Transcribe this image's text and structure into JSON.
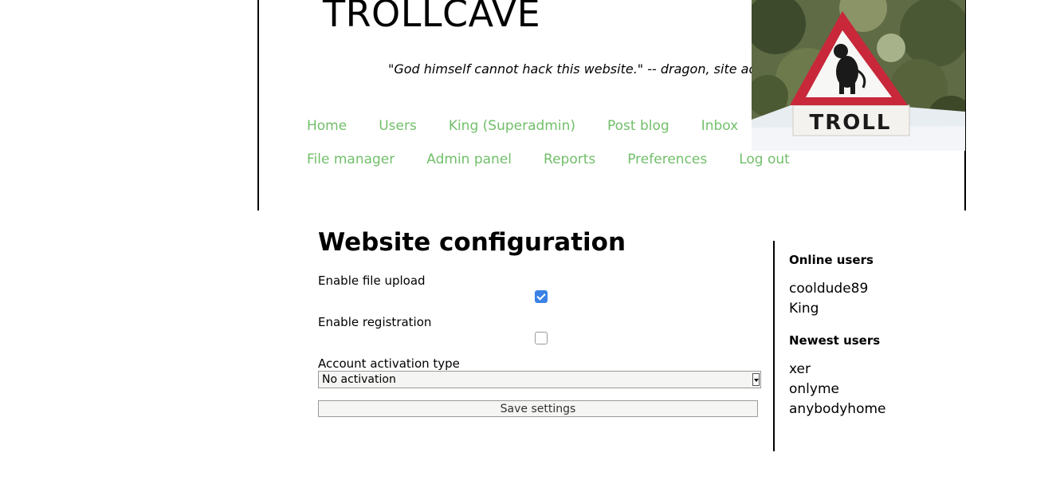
{
  "header": {
    "site_title": "TROLLCAVE",
    "tagline": "\"God himself cannot hack this website.\" -- dragon, site admin",
    "banner_sign_text": "TROLL"
  },
  "nav": {
    "row1": [
      "Home",
      "Users",
      "King (Superadmin)",
      "Post blog",
      "Inbox"
    ],
    "row2": [
      "File manager",
      "Admin panel",
      "Reports",
      "Preferences",
      "Log out"
    ]
  },
  "main": {
    "title": "Website configuration",
    "file_upload_label": "Enable file upload",
    "file_upload_checked": true,
    "registration_label": "Enable registration",
    "registration_checked": false,
    "activation_label": "Account activation type",
    "activation_value": "No activation",
    "save_label": "Save settings"
  },
  "sidebar": {
    "online_heading": "Online users",
    "online_users": [
      "cooldude89",
      "King"
    ],
    "newest_heading": "Newest users",
    "newest_users": [
      "xer",
      "onlyme",
      "anybodyhome"
    ]
  },
  "colors": {
    "nav_link": "#72bf6a",
    "checkbox_checked": "#3b82e6",
    "sign_red": "#c8283a"
  }
}
